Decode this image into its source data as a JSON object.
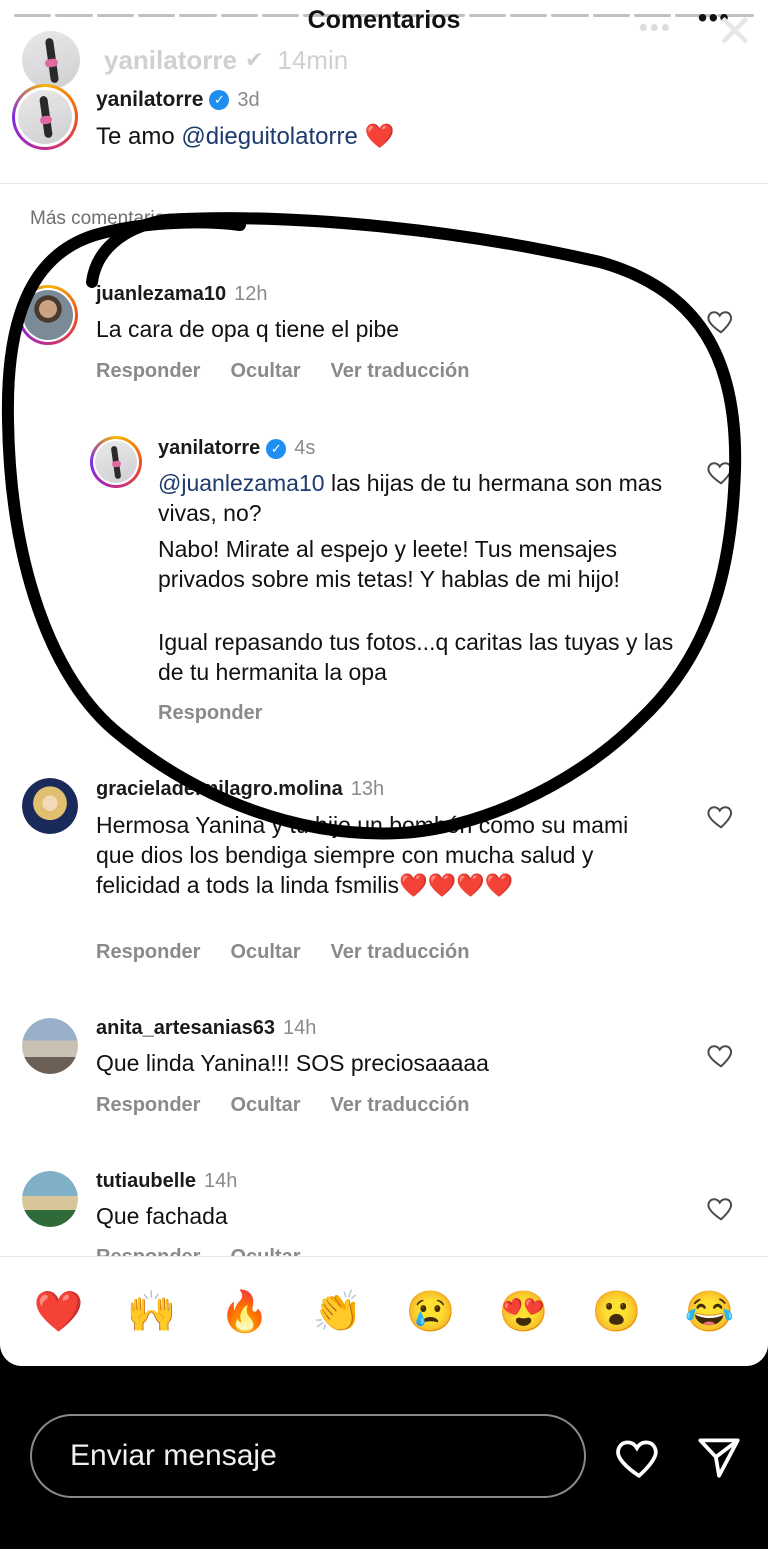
{
  "sheet": {
    "title": "Comentarios",
    "more": "•••"
  },
  "story": {
    "username": "yanilatorre",
    "time": "14min",
    "dots": "•••",
    "close": "✕"
  },
  "caption": {
    "username": "yanilatorre",
    "time": "3d",
    "mention": "@dieguitolatorre",
    "text_prefix": "Te amo ",
    "emoji": "❤️"
  },
  "more_comments": "Más comentarios",
  "comments": [
    {
      "username": "juanlezama10",
      "time": "12h",
      "text": "La cara de opa q tiene el pibe",
      "actions": [
        "Responder",
        "Ocultar",
        "Ver traducción"
      ]
    },
    {
      "username": "yanilatorre",
      "time": "4s",
      "mention": "@juanlezama10",
      "text_after_mention": " las hijas de tu hermana son mas vivas, no?",
      "para2": "Nabo! Mirate al espejo y leete! Tus mensajes privados sobre mis tetas! Y hablas de mi hijo!",
      "para3": "Igual repasando tus fotos...q caritas las tuyas y las de tu hermanita la opa",
      "actions": [
        "Responder"
      ]
    },
    {
      "username": "gracieladelmilagro.molina",
      "time": "13h",
      "text": "Hermosa Yanina y tu hijo un bombón como su mami que dios los bendiga siempre con mucha salud y felicidad a tods la linda fsmilis❤️❤️❤️❤️",
      "actions": [
        "Responder",
        "Ocultar",
        "Ver traducción"
      ]
    },
    {
      "username": "anita_artesanias63",
      "time": "14h",
      "text": "Que linda Yanina!!! SOS preciosaaaaa",
      "actions": [
        "Responder",
        "Ocultar",
        "Ver traducción"
      ]
    },
    {
      "username": "tutiaubelle",
      "time": "14h",
      "text": "Que fachada",
      "actions": [
        "Responder",
        "Ocultar"
      ]
    }
  ],
  "emojis": [
    "❤️",
    "🙌",
    "🔥",
    "👏",
    "😢",
    "😍",
    "😮",
    "😂"
  ],
  "bottom": {
    "placeholder": "Enviar mensaje"
  },
  "colors": {
    "verified": "#1f8ef1",
    "mention": "#1d3a6e",
    "scribble": "#000000"
  }
}
